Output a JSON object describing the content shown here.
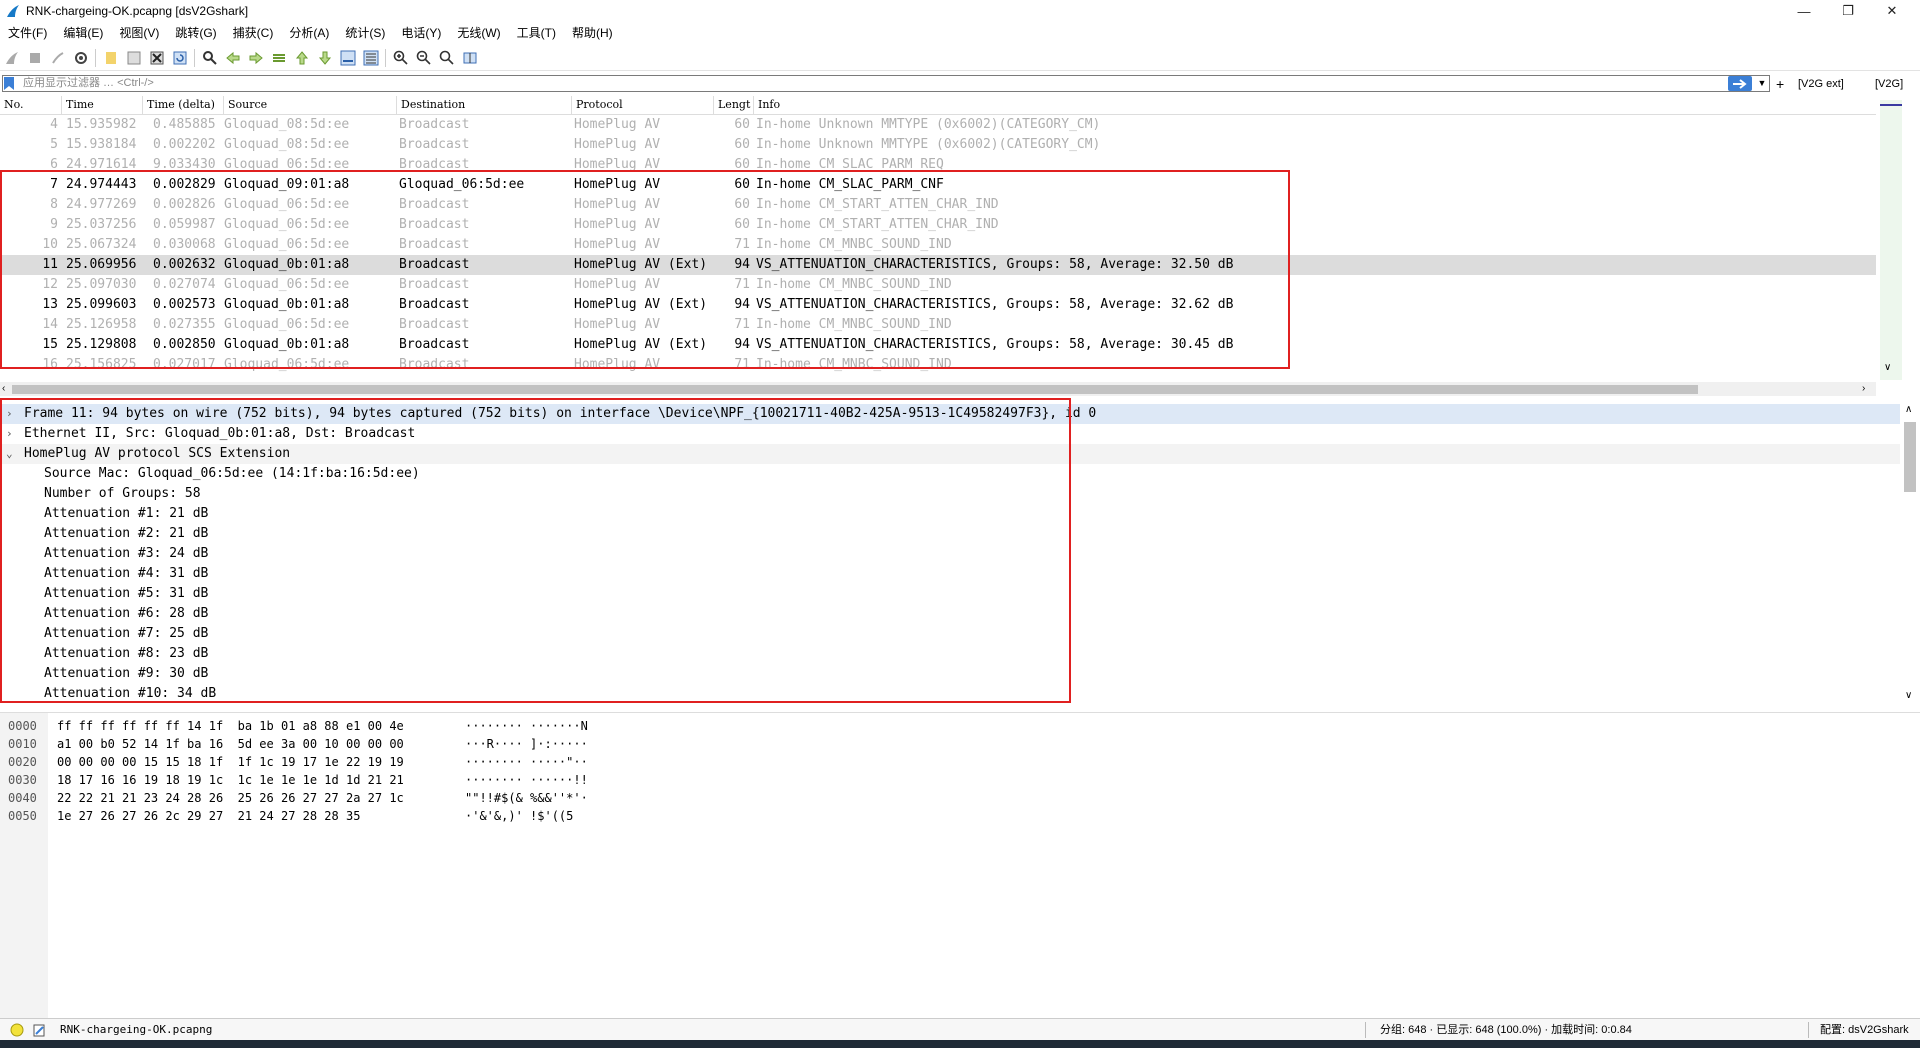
{
  "window": {
    "title": "RNK-chargeing-OK.pcapng [dsV2Gshark]"
  },
  "menu": [
    "文件(F)",
    "编辑(E)",
    "视图(V)",
    "跳转(G)",
    "捕获(C)",
    "分析(A)",
    "统计(S)",
    "电话(Y)",
    "无线(W)",
    "工具(T)",
    "帮助(H)"
  ],
  "filter": {
    "placeholder": "应用显示过滤器 … <Ctrl-/>",
    "plus": "+",
    "button1": "[V2G ext]",
    "button2": "[V2G]"
  },
  "columns": [
    "No.",
    "Time",
    "Time (delta)",
    "Source",
    "Destination",
    "Protocol",
    "Lengt",
    "Info"
  ],
  "packets": [
    {
      "no": "4",
      "time": "15.935982",
      "delta": "0.485885",
      "src": "Gloquad_08:5d:ee",
      "dst": "Broadcast",
      "proto": "HomePlug AV",
      "len": "60",
      "info": "In-home Unknown MMTYPE (0x6002)(CATEGORY_CM)",
      "dim": true
    },
    {
      "no": "5",
      "time": "15.938184",
      "delta": "0.002202",
      "src": "Gloquad_08:5d:ee",
      "dst": "Broadcast",
      "proto": "HomePlug AV",
      "len": "60",
      "info": "In-home Unknown MMTYPE (0x6002)(CATEGORY_CM)",
      "dim": true
    },
    {
      "no": "6",
      "time": "24.971614",
      "delta": "9.033430",
      "src": "Gloquad_06:5d:ee",
      "dst": "Broadcast",
      "proto": "HomePlug AV",
      "len": "60",
      "info": "In-home CM_SLAC_PARM_REQ",
      "dim": true
    },
    {
      "no": "7",
      "time": "24.974443",
      "delta": "0.002829",
      "src": "Gloquad_09:01:a8",
      "dst": "Gloquad_06:5d:ee",
      "proto": "HomePlug AV",
      "len": "60",
      "info": "In-home CM_SLAC_PARM_CNF",
      "dim": false
    },
    {
      "no": "8",
      "time": "24.977269",
      "delta": "0.002826",
      "src": "Gloquad_06:5d:ee",
      "dst": "Broadcast",
      "proto": "HomePlug AV",
      "len": "60",
      "info": "In-home CM_START_ATTEN_CHAR_IND",
      "dim": true
    },
    {
      "no": "9",
      "time": "25.037256",
      "delta": "0.059987",
      "src": "Gloquad_06:5d:ee",
      "dst": "Broadcast",
      "proto": "HomePlug AV",
      "len": "60",
      "info": "In-home CM_START_ATTEN_CHAR_IND",
      "dim": true
    },
    {
      "no": "10",
      "time": "25.067324",
      "delta": "0.030068",
      "src": "Gloquad_06:5d:ee",
      "dst": "Broadcast",
      "proto": "HomePlug AV",
      "len": "71",
      "info": "In-home CM_MNBC_SOUND_IND",
      "dim": true
    },
    {
      "no": "11",
      "time": "25.069956",
      "delta": "0.002632",
      "src": "Gloquad_0b:01:a8",
      "dst": "Broadcast",
      "proto": "HomePlug AV (Ext)",
      "len": "94",
      "info": "VS_ATTENUATION_CHARACTERISTICS, Groups: 58, Average: 32.50 dB",
      "dim": false,
      "selected": true
    },
    {
      "no": "12",
      "time": "25.097030",
      "delta": "0.027074",
      "src": "Gloquad_06:5d:ee",
      "dst": "Broadcast",
      "proto": "HomePlug AV",
      "len": "71",
      "info": "In-home CM_MNBC_SOUND_IND",
      "dim": true
    },
    {
      "no": "13",
      "time": "25.099603",
      "delta": "0.002573",
      "src": "Gloquad_0b:01:a8",
      "dst": "Broadcast",
      "proto": "HomePlug AV (Ext)",
      "len": "94",
      "info": "VS_ATTENUATION_CHARACTERISTICS, Groups: 58, Average: 32.62 dB",
      "dim": false
    },
    {
      "no": "14",
      "time": "25.126958",
      "delta": "0.027355",
      "src": "Gloquad_06:5d:ee",
      "dst": "Broadcast",
      "proto": "HomePlug AV",
      "len": "71",
      "info": "In-home CM_MNBC_SOUND_IND",
      "dim": true
    },
    {
      "no": "15",
      "time": "25.129808",
      "delta": "0.002850",
      "src": "Gloquad_0b:01:a8",
      "dst": "Broadcast",
      "proto": "HomePlug AV (Ext)",
      "len": "94",
      "info": "VS_ATTENUATION_CHARACTERISTICS, Groups: 58, Average: 30.45 dB",
      "dim": false
    },
    {
      "no": "16",
      "time": "25.156825",
      "delta": "0.027017",
      "src": "Gloquad_06:5d:ee",
      "dst": "Broadcast",
      "proto": "HomePlug AV",
      "len": "71",
      "info": "In-home CM_MNBC_SOUND_IND",
      "dim": true
    }
  ],
  "details": [
    {
      "text": "Frame 11: 94 bytes on wire (752 bits), 94 bytes captured (752 bits) on interface \\Device\\NPF_{10021711-40B2-425A-9513-1C49582497F3}, id 0",
      "arrow": ">",
      "indent": 0,
      "style": "hl"
    },
    {
      "text": "Ethernet II, Src: Gloquad_0b:01:a8, Dst: Broadcast",
      "arrow": ">",
      "indent": 0,
      "style": ""
    },
    {
      "text": "HomePlug AV protocol SCS Extension",
      "arrow": "v",
      "indent": 0,
      "style": "sec"
    },
    {
      "text": "Source Mac: Gloquad_06:5d:ee (14:1f:ba:16:5d:ee)",
      "arrow": "",
      "indent": 1,
      "style": ""
    },
    {
      "text": "Number of Groups: 58",
      "arrow": "",
      "indent": 1,
      "style": ""
    },
    {
      "text": "Attenuation #1: 21 dB",
      "arrow": "",
      "indent": 1,
      "style": ""
    },
    {
      "text": "Attenuation #2: 21 dB",
      "arrow": "",
      "indent": 1,
      "style": ""
    },
    {
      "text": "Attenuation #3: 24 dB",
      "arrow": "",
      "indent": 1,
      "style": ""
    },
    {
      "text": "Attenuation #4: 31 dB",
      "arrow": "",
      "indent": 1,
      "style": ""
    },
    {
      "text": "Attenuation #5: 31 dB",
      "arrow": "",
      "indent": 1,
      "style": ""
    },
    {
      "text": "Attenuation #6: 28 dB",
      "arrow": "",
      "indent": 1,
      "style": ""
    },
    {
      "text": "Attenuation #7: 25 dB",
      "arrow": "",
      "indent": 1,
      "style": ""
    },
    {
      "text": "Attenuation #8: 23 dB",
      "arrow": "",
      "indent": 1,
      "style": ""
    },
    {
      "text": "Attenuation #9: 30 dB",
      "arrow": "",
      "indent": 1,
      "style": ""
    },
    {
      "text": "Attenuation #10: 34 dB",
      "arrow": "",
      "indent": 1,
      "style": ""
    }
  ],
  "bytes": [
    {
      "offset": "0000",
      "hex": "ff ff ff ff ff ff 14 1f  ba 1b 01 a8 88 e1 00 4e",
      "ascii": "········ ·······N"
    },
    {
      "offset": "0010",
      "hex": "a1 00 b0 52 14 1f ba 16  5d ee 3a 00 10 00 00 00",
      "ascii": "···R···· ]·:·····"
    },
    {
      "offset": "0020",
      "hex": "00 00 00 00 15 15 18 1f  1f 1c 19 17 1e 22 19 19",
      "ascii": "········ ·····\"··"
    },
    {
      "offset": "0030",
      "hex": "18 17 16 16 19 18 19 1c  1c 1e 1e 1e 1d 1d 21 21",
      "ascii": "········ ······!!"
    },
    {
      "offset": "0040",
      "hex": "22 22 21 21 23 24 28 26  25 26 26 27 27 2a 27 1c",
      "ascii": "\"\"!!#$(& %&&''*'·"
    },
    {
      "offset": "0050",
      "hex": "1e 27 26 27 26 2c 29 27  21 24 27 28 28 35",
      "ascii": "·'&'&,)' !$'((5"
    }
  ],
  "status": {
    "file": "RNK-chargeing-OK.pcapng",
    "packets": "分组: 648 · 已显示: 648 (100.0%) · 加载时间: 0:0.84",
    "profile": "配置: dsV2Gshark"
  }
}
